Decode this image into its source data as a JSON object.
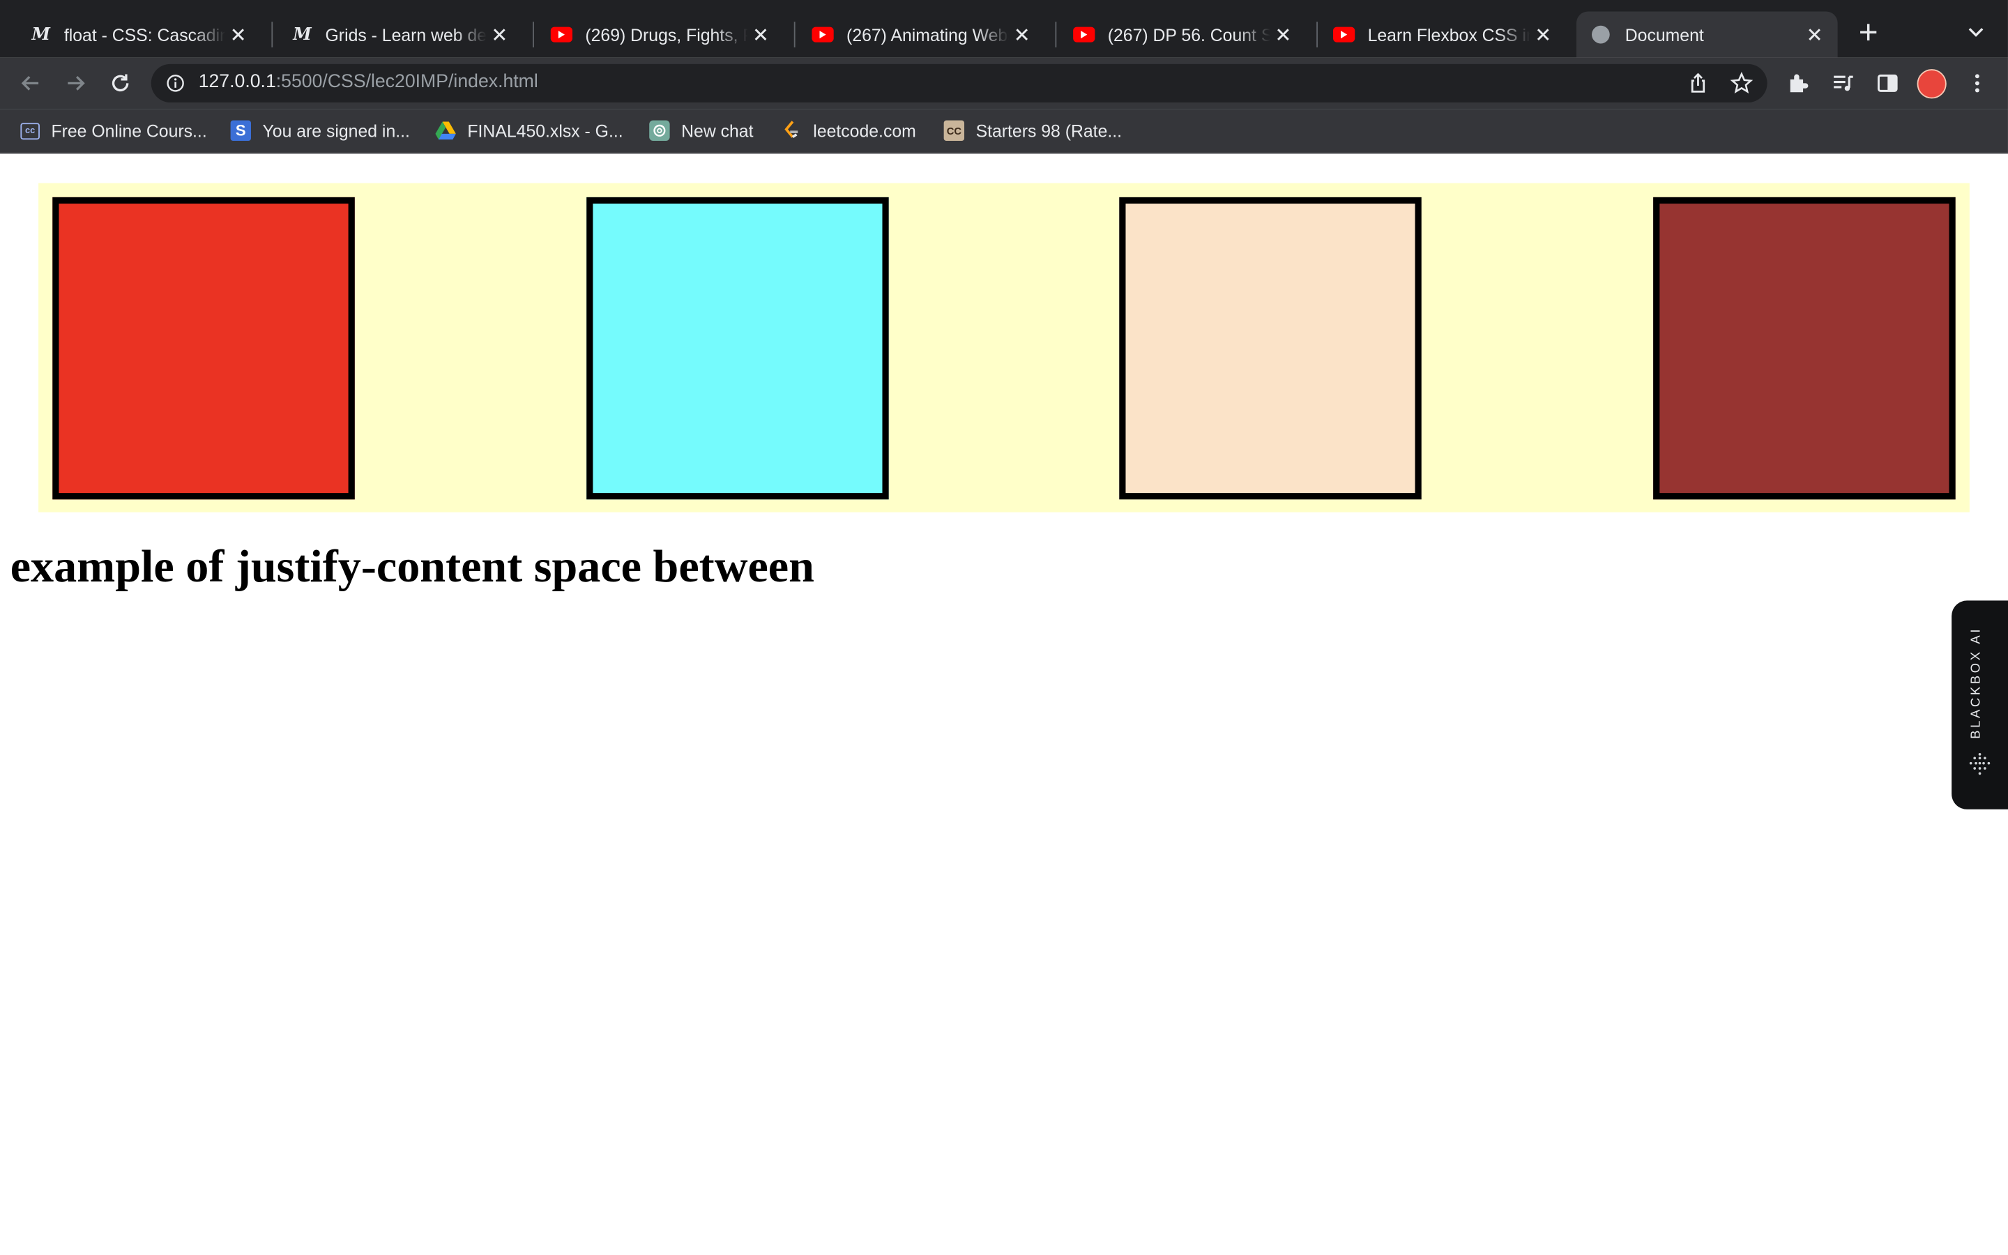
{
  "browser": {
    "tabs": [
      {
        "title": "float - CSS: Cascading Style Sheets | MDN",
        "favicon": "mdn-icon"
      },
      {
        "title": "Grids - Learn web development | MDN",
        "favicon": "mdn-icon"
      },
      {
        "title": "(269) Drugs, Fights, Po",
        "favicon": "youtube-icon"
      },
      {
        "title": "(267) Animating Websites",
        "favicon": "youtube-icon"
      },
      {
        "title": "(267) DP 56. Count Square",
        "favicon": "youtube-icon"
      },
      {
        "title": "Learn Flexbox CSS in 8",
        "favicon": "youtube-icon"
      },
      {
        "title": "Document",
        "favicon": "globe-icon",
        "active": true
      }
    ],
    "url_host": "127.0.0.1",
    "url_rest": ":5500/CSS/lec20IMP/index.html",
    "bookmarks": [
      {
        "label": "Free Online Cours...",
        "icon": "cc-icon"
      },
      {
        "label": "You are signed in...",
        "icon": "s-icon"
      },
      {
        "label": "FINAL450.xlsx - G...",
        "icon": "drive-icon"
      },
      {
        "label": "New chat",
        "icon": "chatgpt-icon"
      },
      {
        "label": "leetcode.com",
        "icon": "leetcode-icon"
      },
      {
        "label": "Starters 98 (Rate...",
        "icon": "codechef-icon"
      }
    ]
  },
  "page": {
    "boxes": [
      {
        "color": "#ea3323"
      },
      {
        "color": "#75fbfd"
      },
      {
        "color": "#fbe3c8"
      },
      {
        "color": "#973431"
      }
    ],
    "container_color": "#ffffc9",
    "heading": "example of justify-content space between"
  },
  "extension": {
    "label": "BLACKBOX AI"
  }
}
